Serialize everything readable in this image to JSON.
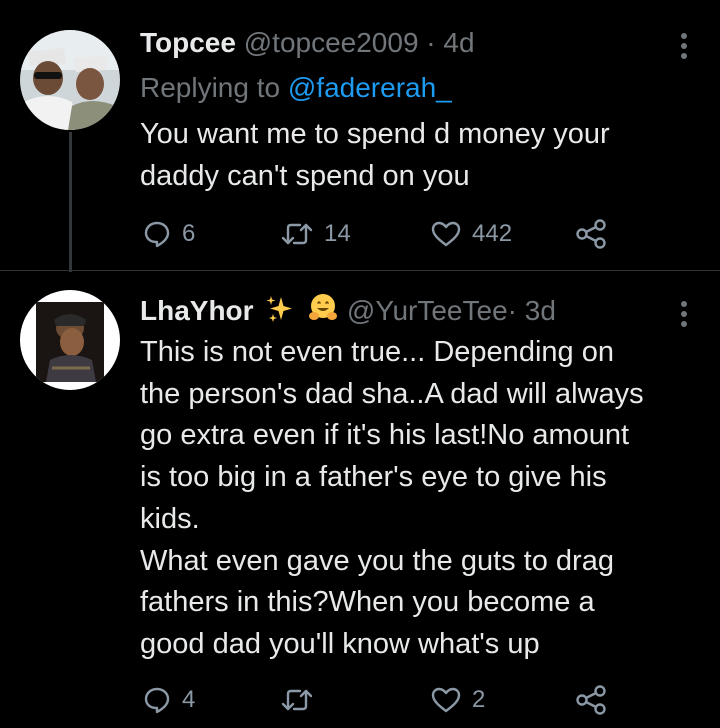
{
  "theme": {
    "background": "#000000",
    "text": "#e7e9ea",
    "muted": "#71767b",
    "accent": "#1d9bf0",
    "icon": "#8b98a5"
  },
  "tweets": [
    {
      "name": "Topcee",
      "handle": "@topcee2009",
      "separator": "·",
      "time": "4d",
      "replying_prefix": "Replying to",
      "replying_to": "@fadererah_",
      "text": "You want me to spend d money your\ndaddy can't spend on you",
      "reply_count": "6",
      "retweet_count": "14",
      "like_count": "442",
      "avatar_icon": "profile-photo-two-men"
    },
    {
      "name": "LhaYhor",
      "emojis": [
        "sparkles-icon",
        "hugging-face-icon"
      ],
      "handle": "@YurTeeTee",
      "separator": "·",
      "time": "3d",
      "text": "This is not even true... Depending on\nthe person's dad sha..A dad will always\ngo extra even if it's his last!No amount\nis too big in a father's eye to give his\nkids.\nWhat even gave you the guts to drag\nfathers in this?When you become a\ngood dad you'll know what's up",
      "reply_count": "4",
      "retweet_count": "",
      "like_count": "2",
      "avatar_icon": "profile-photo-person"
    }
  ]
}
